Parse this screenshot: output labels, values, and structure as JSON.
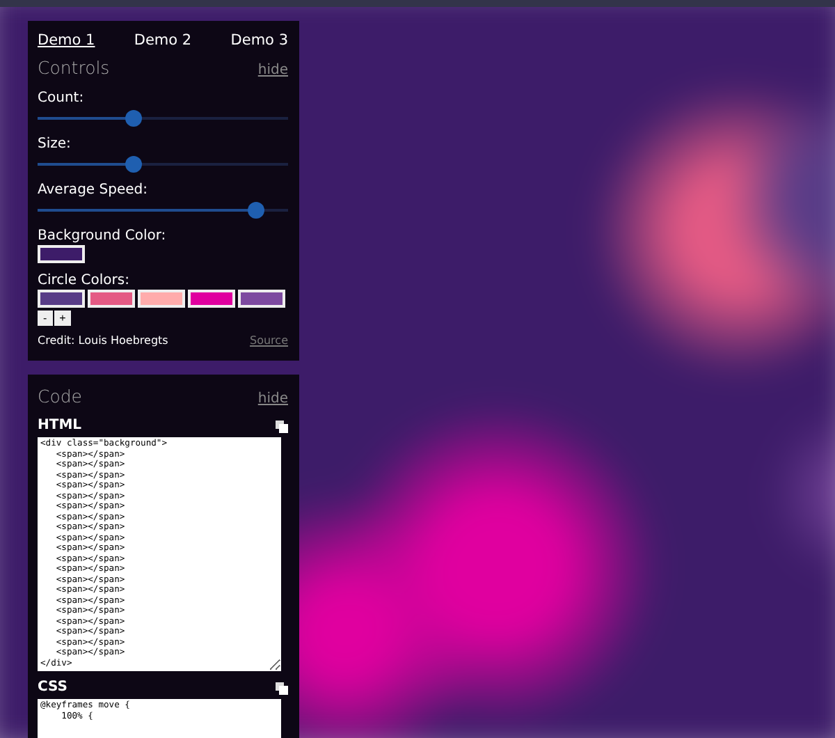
{
  "tabs": [
    {
      "label": "Demo 1",
      "selected": true
    },
    {
      "label": "Demo 2",
      "selected": false
    },
    {
      "label": "Demo 3",
      "selected": false
    }
  ],
  "controls": {
    "title": "Controls",
    "hide_link": "hide",
    "sliders": [
      {
        "label": "Count:",
        "level": 0.39
      },
      {
        "label": "Size:",
        "level": 0.39
      },
      {
        "label": "Average Speed:",
        "level": 0.88
      }
    ],
    "background_color": {
      "label": "Background Color:",
      "color": "#3d1c69"
    },
    "circle_colors": {
      "label": "Circle Colors:",
      "swatches": [
        {
          "color": "#583c87"
        },
        {
          "color": "#e45a84"
        },
        {
          "color": "#ffacac"
        },
        {
          "color": "#e0009f"
        },
        {
          "color": "#7d4aa0"
        }
      ],
      "remove_button": "-",
      "add_button": "+"
    },
    "credit": "Credit: Louis Hoebregts",
    "source_link": "Source"
  },
  "code": {
    "title": "Code",
    "hide_link": "hide",
    "sections": [
      {
        "label": "HTML",
        "content": "<div class=\"background\">\n   <span></span>\n   <span></span>\n   <span></span>\n   <span></span>\n   <span></span>\n   <span></span>\n   <span></span>\n   <span></span>\n   <span></span>\n   <span></span>\n   <span></span>\n   <span></span>\n   <span></span>\n   <span></span>\n   <span></span>\n   <span></span>\n   <span></span>\n   <span></span>\n   <span></span>\n   <span></span>\n</div>"
      },
      {
        "label": "CSS",
        "content": "@keyframes move {\n    100% {"
      }
    ]
  }
}
